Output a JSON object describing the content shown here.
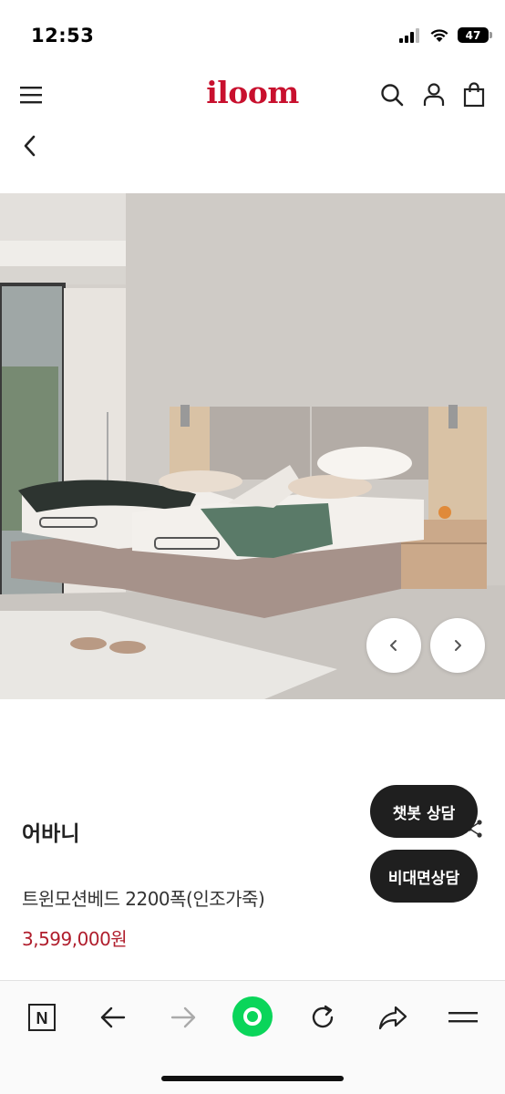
{
  "status": {
    "time": "12:53",
    "battery": "47"
  },
  "header": {
    "logo": "iloom",
    "menu_icon": "hamburger-menu-icon",
    "search_icon": "search-icon",
    "account_icon": "user-icon",
    "cart_icon": "shopping-bag-icon",
    "back_icon": "chevron-left-icon"
  },
  "hero": {
    "image": "motion-bed-bedroom-photo",
    "prev_icon": "chevron-left-icon",
    "next_icon": "chevron-right-icon"
  },
  "product": {
    "brand": "어바니",
    "name": "트윈모션베드 2200폭(인조가죽)",
    "price": "3,599,000원"
  },
  "floating": {
    "chatbot_label": "챗봇 상담",
    "consult_label": "비대면상담",
    "share_icon": "share-icon"
  },
  "browser_bar": {
    "icons": [
      "naver-n-icon",
      "back-arrow-icon",
      "forward-arrow-icon",
      "green-circle-home-icon",
      "reload-icon",
      "share-arrow-icon",
      "menu-lines-icon"
    ]
  },
  "colors": {
    "brand": "#c8102e",
    "price": "#b01e2d",
    "pill_bg": "#1f1f1f",
    "green": "#0ad55a"
  }
}
